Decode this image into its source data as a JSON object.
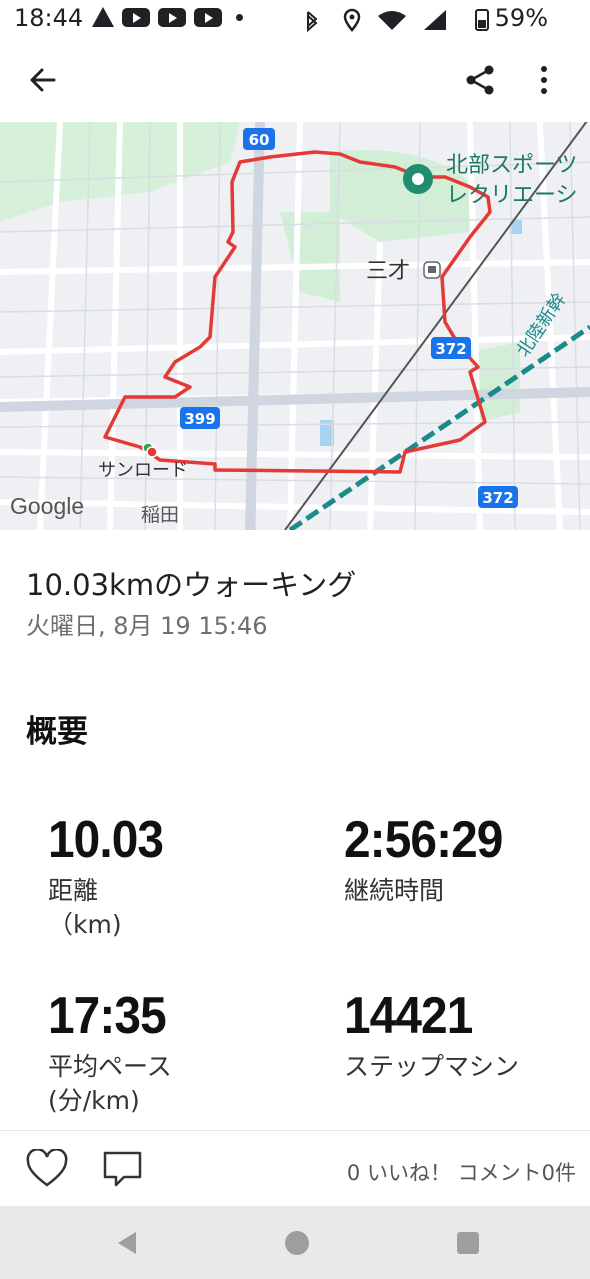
{
  "status_bar": {
    "time": "18:44",
    "battery": "59%"
  },
  "toolbar": {
    "back_icon": "arrow-back-icon",
    "share_icon": "share-icon",
    "menu_icon": "more-vert-icon"
  },
  "map": {
    "labels": {
      "route60": "60",
      "route399": "399",
      "route372a": "372",
      "route372b": "372",
      "place1_line1": "北部スポーツ",
      "place1_line2": "レクリエーシ",
      "station": "三才",
      "rail": "北陸新幹",
      "sunroad": "サンロード",
      "inada": "稲田",
      "google": "Google"
    },
    "colors": {
      "route": "#e53935",
      "park": "#cfeed4",
      "water": "#a7d3f3"
    }
  },
  "activity": {
    "title": "10.03kmのウォーキング",
    "subtitle": "火曜日, 8月 19 15:46"
  },
  "summary": {
    "heading": "概要",
    "metrics": [
      {
        "value": "10.03",
        "label": "距離",
        "unit": "（km)"
      },
      {
        "value": "2:56:29",
        "label": "継続時間",
        "unit": ""
      },
      {
        "value": "17:35",
        "label": "平均ペース",
        "unit": "(分/km)"
      },
      {
        "value": "14421",
        "label": "ステップマシン",
        "unit": ""
      }
    ]
  },
  "footer": {
    "like_icon": "heart-icon",
    "comment_icon": "comment-icon",
    "counts": "0 いいね！ コメント0件"
  },
  "nav": {
    "back": "nav-back-icon",
    "home": "nav-home-icon",
    "recents": "nav-recents-icon"
  }
}
